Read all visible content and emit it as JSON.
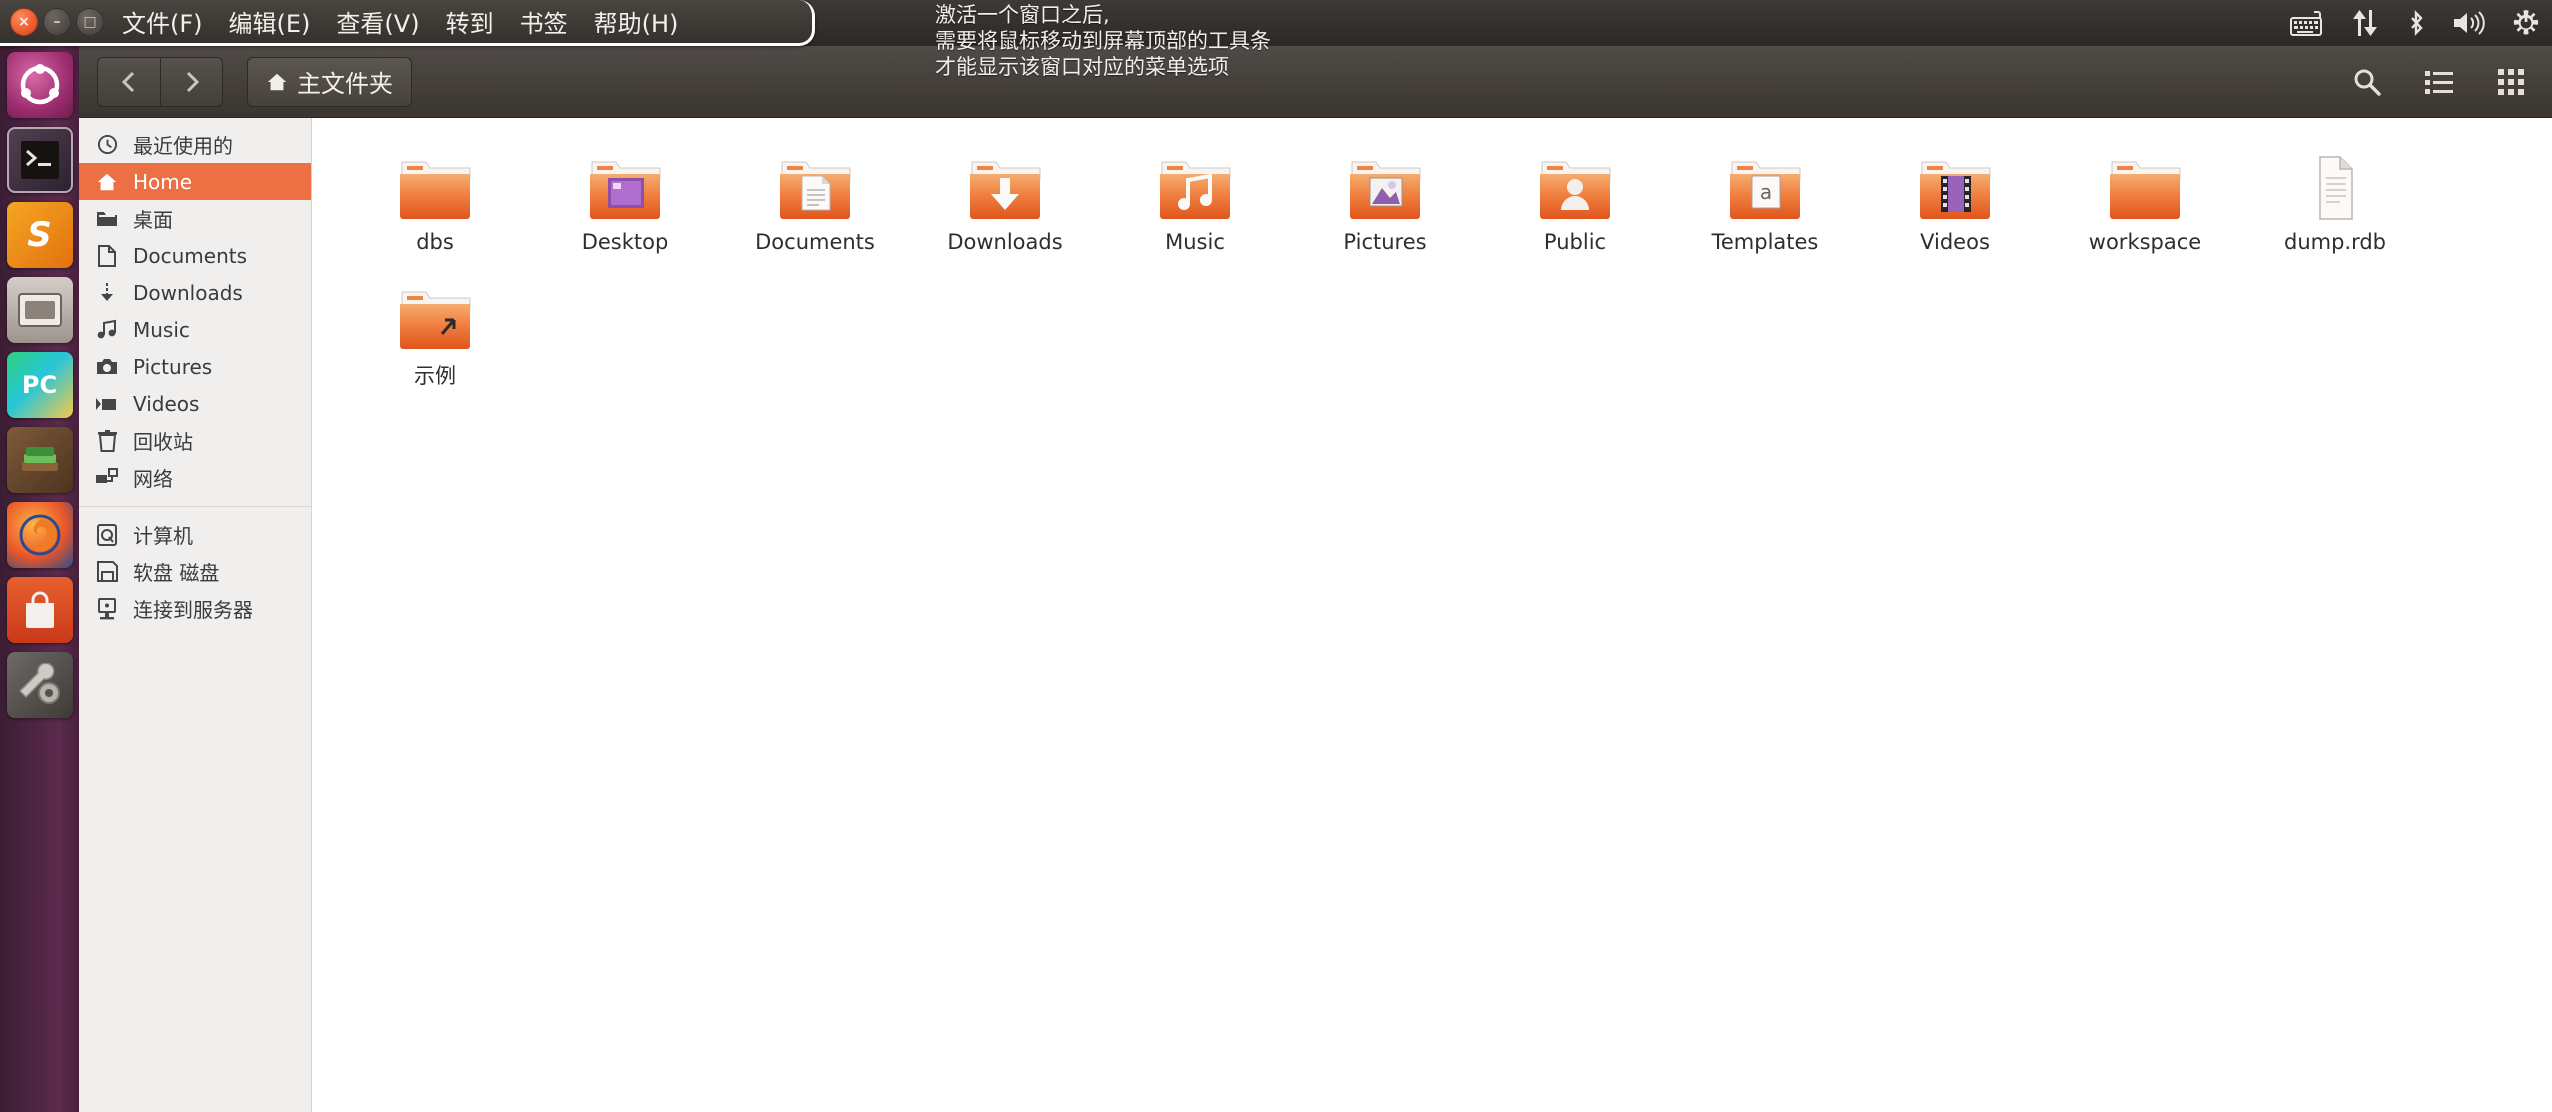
{
  "panel": {
    "window_controls": [
      {
        "name": "close",
        "glyph": "×"
      },
      {
        "name": "minimize",
        "glyph": "–"
      },
      {
        "name": "maximize",
        "glyph": "□"
      }
    ],
    "menus": [
      "文件(F)",
      "编辑(E)",
      "查看(V)",
      "转到",
      "书签",
      "帮助(H)"
    ],
    "annotation_lines": [
      "激活一个窗口之后,",
      "需要将鼠标移动到屏幕顶部的工具条",
      "才能显示该窗口对应的菜单选项"
    ],
    "tray_icons": [
      "keyboard-icon",
      "network-transfer-icon",
      "bluetooth-icon",
      "volume-icon",
      "system-settings-icon"
    ]
  },
  "launcher": {
    "items": [
      {
        "name": "ubuntu-dash",
        "label": "Ubuntu"
      },
      {
        "name": "terminal",
        "label": "Terminal"
      },
      {
        "name": "sublime-text",
        "label": "S"
      },
      {
        "name": "files-nautilus",
        "label": "Files"
      },
      {
        "name": "pycharm",
        "label": "PC"
      },
      {
        "name": "calibre",
        "label": "Calibre"
      },
      {
        "name": "firefox",
        "label": "Firefox"
      },
      {
        "name": "software-center",
        "label": "A"
      },
      {
        "name": "system-settings",
        "label": "Settings"
      }
    ]
  },
  "toolbar": {
    "back_label": "‹",
    "forward_label": "›",
    "breadcrumb_label": "主文件夹",
    "search_label": "search-icon",
    "list_view_label": "list-view-icon",
    "grid_view_label": "grid-view-icon"
  },
  "sidebar": {
    "group1": [
      {
        "icon": "clock-icon",
        "label": "最近使用的",
        "active": false
      },
      {
        "icon": "home-icon",
        "label": "Home",
        "active": true
      },
      {
        "icon": "folder-icon",
        "label": "桌面",
        "active": false
      },
      {
        "icon": "document-icon",
        "label": "Documents",
        "active": false
      },
      {
        "icon": "download-icon",
        "label": "Downloads",
        "active": false
      },
      {
        "icon": "music-icon",
        "label": "Music",
        "active": false
      },
      {
        "icon": "camera-icon",
        "label": "Pictures",
        "active": false
      },
      {
        "icon": "video-icon",
        "label": "Videos",
        "active": false
      },
      {
        "icon": "trash-icon",
        "label": "回收站",
        "active": false
      },
      {
        "icon": "network-icon",
        "label": "网络",
        "active": false
      }
    ],
    "group2": [
      {
        "icon": "harddisk-icon",
        "label": "计算机",
        "active": false
      },
      {
        "icon": "floppy-icon",
        "label": "软盘 磁盘",
        "active": false
      },
      {
        "icon": "server-icon",
        "label": "连接到服务器",
        "active": false
      }
    ]
  },
  "files": {
    "items": [
      {
        "name": "dbs",
        "type": "folder",
        "overlay": "none"
      },
      {
        "name": "Desktop",
        "type": "folder",
        "overlay": "desktop"
      },
      {
        "name": "Documents",
        "type": "folder",
        "overlay": "document"
      },
      {
        "name": "Downloads",
        "type": "folder",
        "overlay": "download"
      },
      {
        "name": "Music",
        "type": "folder",
        "overlay": "music"
      },
      {
        "name": "Pictures",
        "type": "folder",
        "overlay": "picture"
      },
      {
        "name": "Public",
        "type": "folder",
        "overlay": "public"
      },
      {
        "name": "Templates",
        "type": "folder",
        "overlay": "template"
      },
      {
        "name": "Videos",
        "type": "folder",
        "overlay": "video"
      },
      {
        "name": "workspace",
        "type": "folder",
        "overlay": "none"
      },
      {
        "name": "dump.rdb",
        "type": "file",
        "overlay": "none"
      },
      {
        "name": "示例",
        "type": "folder",
        "overlay": "link"
      }
    ]
  },
  "colors": {
    "accent": "#ed7045",
    "folder": "#ea7b3c",
    "panel": "#35312d",
    "launcher": "#4b2340",
    "sidebar_bg": "#f0efee"
  }
}
